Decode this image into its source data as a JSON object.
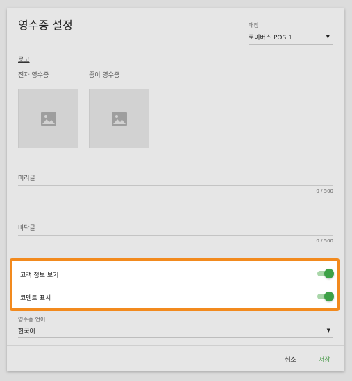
{
  "dialog": {
    "title": "영수증 설정",
    "store": {
      "label": "매장",
      "value": "로이버스 POS 1"
    },
    "logo": {
      "heading": "로고",
      "electronic_label": "전자 영수증",
      "paper_label": "종이 영수증"
    },
    "header_field": {
      "label": "머리글",
      "counter": "0 / 500"
    },
    "footer_field": {
      "label": "바닥글",
      "counter": "0 / 500"
    },
    "toggles": [
      {
        "label": "고객 정보 보기",
        "on": true
      },
      {
        "label": "코멘트 표시",
        "on": true
      }
    ],
    "language": {
      "label": "영수증 언어",
      "value": "한국어"
    },
    "buttons": {
      "cancel": "취소",
      "save": "저장"
    }
  },
  "colors": {
    "highlight_border": "#f28a1e",
    "toggle_on": "#3da147",
    "save_text": "#4a9a4a"
  }
}
